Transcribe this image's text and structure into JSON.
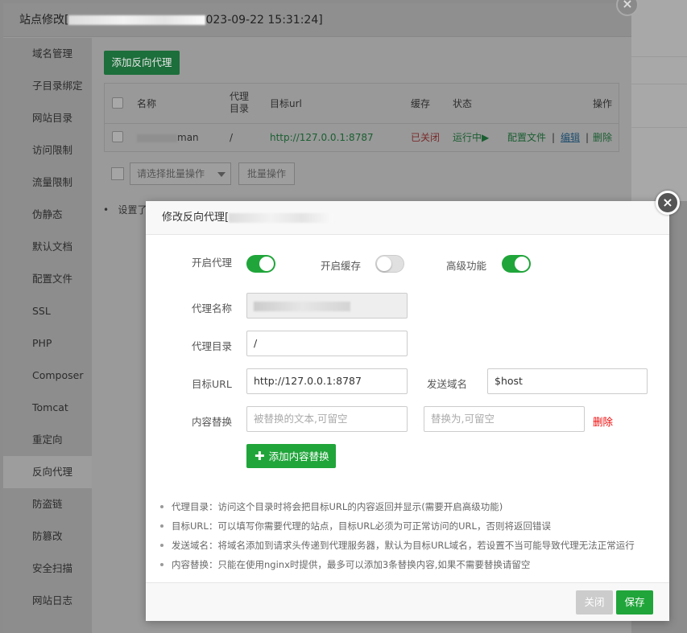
{
  "outer": {
    "title": "站点修改[",
    "title_tail": "023-09-22 15:31:24]",
    "close": "×",
    "sidebar": [
      {
        "label": "域名管理"
      },
      {
        "label": "子目录绑定"
      },
      {
        "label": "网站目录"
      },
      {
        "label": "访问限制"
      },
      {
        "label": "流量限制"
      },
      {
        "label": "伪静态"
      },
      {
        "label": "默认文档"
      },
      {
        "label": "配置文件"
      },
      {
        "label": "SSL"
      },
      {
        "label": "PHP"
      },
      {
        "label": "Composer"
      },
      {
        "label": "Tomcat"
      },
      {
        "label": "重定向"
      },
      {
        "label": "反向代理",
        "active": true
      },
      {
        "label": "防盗链"
      },
      {
        "label": "防篡改"
      },
      {
        "label": "安全扫描"
      },
      {
        "label": "网站日志"
      }
    ],
    "add_proxy_button": "添加反向代理",
    "table": {
      "headers": {
        "name": "名称",
        "dir": "代理目录",
        "target": "目标url",
        "cache": "缓存",
        "status": "状态",
        "ops": "操作"
      },
      "row": {
        "name": "man",
        "dir": "/",
        "target": "http://127.0.0.1:8787",
        "cache": "已关闭",
        "status": "运行中▶",
        "config": "配置文件",
        "sep1": "|",
        "edit": "编辑",
        "sep2": "|",
        "delete": "删除"
      }
    },
    "batch_select_placeholder": "请选择批量操作",
    "batch_button": "批量操作",
    "hint": "设置了"
  },
  "dialog": {
    "title": "修改反向代理[",
    "close": "×",
    "toggles": {
      "proxy": {
        "label": "开启代理",
        "on": true
      },
      "cache": {
        "label": "开启缓存",
        "on": false
      },
      "advanced": {
        "label": "高级功能",
        "on": true
      }
    },
    "fields": {
      "name_label": "代理名称",
      "name_value": "",
      "dir_label": "代理目录",
      "dir_value": "/",
      "url_label": "目标URL",
      "url_value": "http://127.0.0.1:8787",
      "host_label": "发送域名",
      "host_value": "$host",
      "replace_label": "内容替换",
      "replace_from_placeholder": "被替换的文本,可留空",
      "replace_to_placeholder": "替换为,可留空",
      "replace_delete": "删除"
    },
    "add_replace_button": "添加内容替换",
    "tips": [
      "代理目录：访问这个目录时将会把目标URL的内容返回并显示(需要开启高级功能)",
      "目标URL：可以填写你需要代理的站点，目标URL必须为可正常访问的URL，否则将返回错误",
      "发送域名：将域名添加到请求头传递到代理服务器，默认为目标URL域名，若设置不当可能导致代理无法正常运行",
      "内容替换：只能在使用nginx时提供，最多可以添加3条替换内容,如果不需要替换请留空"
    ],
    "footer": {
      "close": "关闭",
      "save": "保存"
    }
  }
}
